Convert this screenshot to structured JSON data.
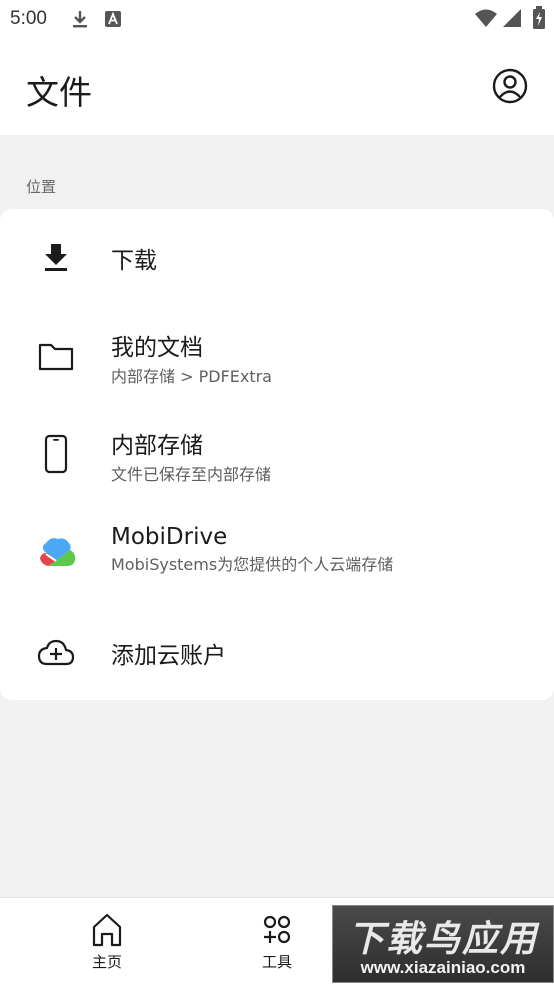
{
  "status_bar": {
    "time": "5:00",
    "icons": [
      "download-icon",
      "keyboard-a-icon",
      "wifi-icon",
      "signal-icon",
      "battery-charging-icon"
    ]
  },
  "app_bar": {
    "title": "文件",
    "account_icon": "account-circle-icon"
  },
  "section": {
    "label": "位置"
  },
  "locations": [
    {
      "icon": "download-icon",
      "title": "下载",
      "subtitle": ""
    },
    {
      "icon": "folder-icon",
      "title": "我的文档",
      "subtitle": "内部存储 > PDFExtra"
    },
    {
      "icon": "phone-icon",
      "title": "内部存储",
      "subtitle": "文件已保存至内部存储"
    },
    {
      "icon": "mobidrive-logo-icon",
      "title": "MobiDrive",
      "subtitle": "MobiSystems为您提供的个人云端存储"
    },
    {
      "icon": "cloud-add-icon",
      "title": "添加云账户",
      "subtitle": ""
    }
  ],
  "bottom_nav": [
    {
      "icon": "home-icon",
      "label": "主页"
    },
    {
      "icon": "tools-icon",
      "label": "工具"
    }
  ],
  "watermark": {
    "text": "下载鸟应用",
    "url": "www.xiazainiao.com"
  },
  "colors": {
    "background": "#f1f1f1",
    "surface": "#ffffff",
    "text_primary": "#1b1b1b",
    "text_secondary": "#5f5f5f",
    "mobidrive_blue": "#4aa8f5",
    "mobidrive_green": "#5cc94a",
    "mobidrive_red": "#e8434b"
  }
}
